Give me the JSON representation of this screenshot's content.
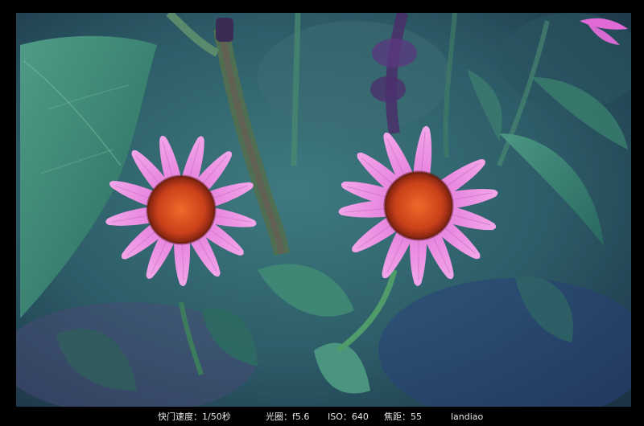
{
  "photo": {
    "subject": "two pink coneflowers",
    "colors": {
      "background": "#2f5d66",
      "petal": "#e27ad9",
      "center": "#d2461c",
      "leaf": "#3f8a78"
    }
  },
  "caption": {
    "shutter": "快门速度：1/50秒",
    "aperture": "光圈：f5.6",
    "iso": "ISO：640",
    "focal": "焦距：55",
    "author": "landiao"
  }
}
